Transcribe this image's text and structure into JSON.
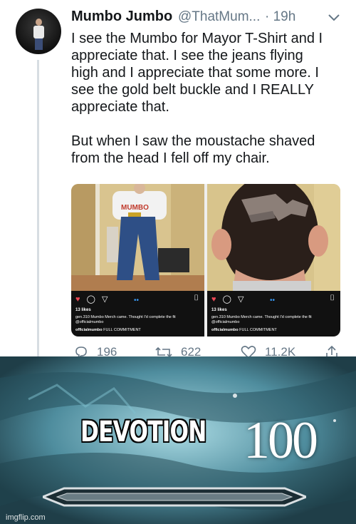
{
  "tweet": {
    "author_name": "Mumbo Jumbo",
    "handle": "@ThatMum...",
    "time": "· 19h",
    "lines": [
      "I see the Mumbo for Mayor T-Shirt and I",
      "appreciate that. I see the jeans flying",
      "high and I appreciate that some more. I",
      "see the gold belt buckle and I REALLY",
      "appreciate that."
    ],
    "lines2": [
      "But when I saw the moustache shaved",
      "from the head I fell off my chair."
    ],
    "media": {
      "left": {
        "shirt_text": "MUMBO",
        "likes": "13 likes",
        "caption": "gen.310 Mumbo Merch came. Thought I'd complete the fit @officialmumbo",
        "comment_user": "officialmumbo",
        "comment_text": "FULL COMMITMENT"
      },
      "right": {
        "likes": "13 likes",
        "caption": "gen.310 Mumbo Merch came. Thought I'd complete the fit @officialmumbo",
        "comment_user": "officialmumbo",
        "comment_text": "FULL COMMITMENT"
      }
    },
    "actions": {
      "reply_count": "196",
      "retweet_count": "622",
      "like_count": "11.2K"
    }
  },
  "meme": {
    "skill_name": "DEVOTION",
    "skill_level": "100",
    "watermark": "imgflip.com"
  },
  "colors": {
    "text": "#14171a",
    "muted": "#657786",
    "heart": "#ed4956"
  }
}
